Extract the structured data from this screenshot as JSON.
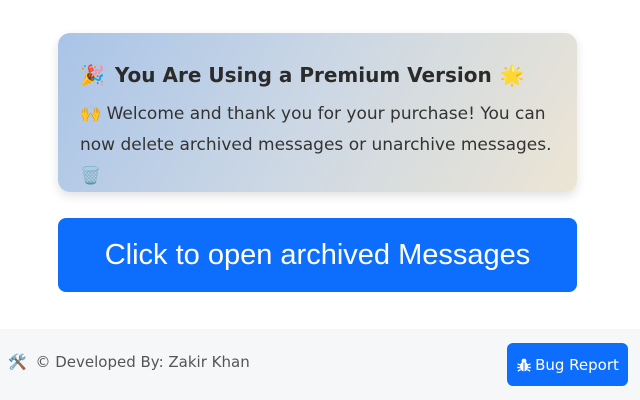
{
  "premium_card": {
    "title_emoji": "🎉",
    "title": "You Are Using a Premium Version",
    "title_emoji_after": "🌟",
    "body_emoji": "🙌",
    "body": "Welcome and thank you for your purchase! You can now delete archived messages or unarchive messages.",
    "body_emoji_after": "🗑️"
  },
  "open_button": {
    "label": "Click to open archived Messages"
  },
  "footer": {
    "tools_emoji": "🛠️",
    "credit": "© Developed By: Zakir Khan",
    "bug_report_label": "Bug Report"
  },
  "colors": {
    "primary": "#0d6efd",
    "footer_bg": "#f6f7f9"
  },
  "icons": {
    "bug": "bug-icon"
  }
}
